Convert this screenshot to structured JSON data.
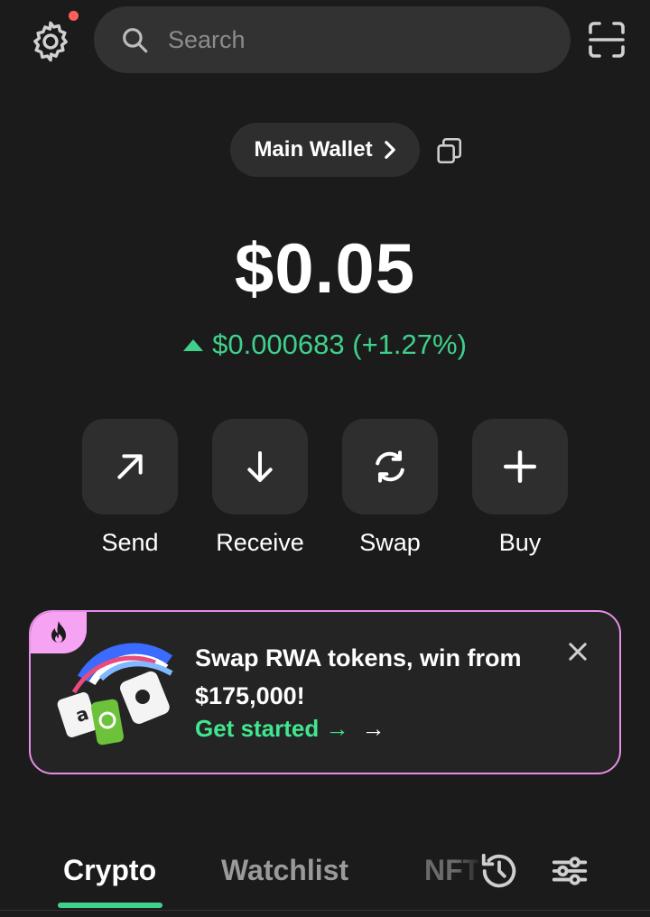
{
  "header": {
    "search_placeholder": "Search",
    "settings_icon": "gear-icon",
    "scan_icon": "qr-scan-icon",
    "notification_dot_color": "#ff5f5a"
  },
  "wallet": {
    "name": "Main Wallet",
    "balance": "$0.05",
    "change": "$0.000683 (+1.27%)",
    "change_direction": "up",
    "change_color": "#3fd18c"
  },
  "actions": [
    {
      "label": "Send",
      "icon": "arrow-up-right-icon"
    },
    {
      "label": "Receive",
      "icon": "arrow-down-icon"
    },
    {
      "label": "Swap",
      "icon": "swap-refresh-icon"
    },
    {
      "label": "Buy",
      "icon": "plus-icon"
    }
  ],
  "promo": {
    "title": "Swap RWA tokens, win from $175,000!",
    "cta": "Get started →",
    "cta_arrow": "→",
    "accent_color": "#e58ee6",
    "cta_color": "#41e68f",
    "badge_icon": "flame-icon"
  },
  "tabs": [
    {
      "label": "Crypto",
      "active": true
    },
    {
      "label": "Watchlist",
      "active": false
    },
    {
      "label": "NFTs",
      "active": false
    }
  ],
  "tab_nft_visible": "NFT",
  "tab_icons": [
    "history-icon",
    "filter-sliders-icon"
  ]
}
